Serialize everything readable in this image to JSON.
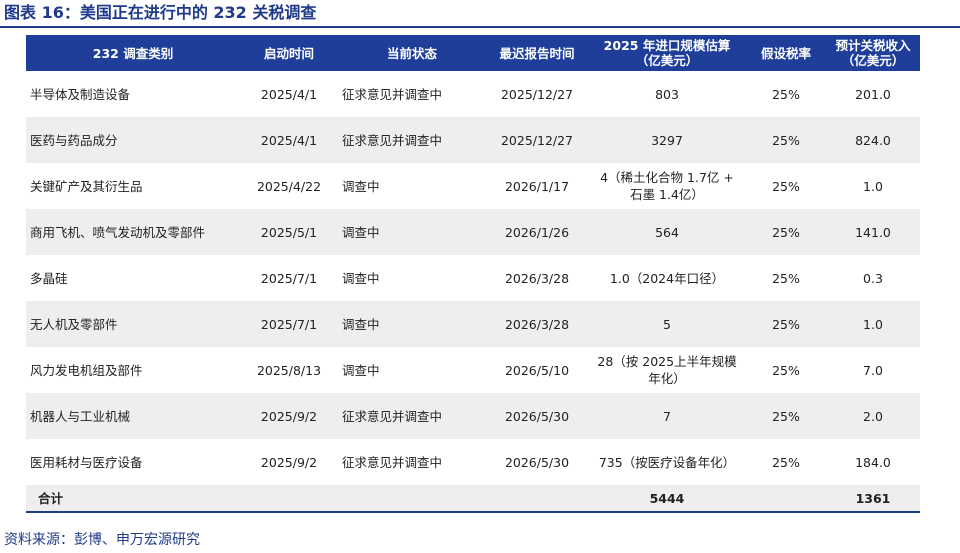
{
  "title": "图表 16：美国正在进行中的 232 关税调查",
  "table": {
    "headers": {
      "category": "232 调查类别",
      "start": "启动时间",
      "status": "当前状态",
      "report": "最迟报告时间",
      "import": "2025 年进口规模估算（亿美元）",
      "rate": "假设税率",
      "tariff": "预计关税收入（亿美元）"
    },
    "rows": [
      {
        "category": "半导体及制造设备",
        "start": "2025/4/1",
        "status": "征求意见并调查中",
        "report": "2025/12/27",
        "import": "803",
        "rate": "25%",
        "tariff": "201.0"
      },
      {
        "category": "医药与药品成分",
        "start": "2025/4/1",
        "status": "征求意见并调查中",
        "report": "2025/12/27",
        "import": "3297",
        "rate": "25%",
        "tariff": "824.0"
      },
      {
        "category": "关键矿产及其衍生品",
        "start": "2025/4/22",
        "status": "调查中",
        "report": "2026/1/17",
        "import": "4（稀土化合物 1.7亿 + 石墨 1.4亿）",
        "rate": "25%",
        "tariff": "1.0"
      },
      {
        "category": "商用飞机、喷气发动机及零部件",
        "start": "2025/5/1",
        "status": "调查中",
        "report": "2026/1/26",
        "import": "564",
        "rate": "25%",
        "tariff": "141.0"
      },
      {
        "category": "多晶硅",
        "start": "2025/7/1",
        "status": "调查中",
        "report": "2026/3/28",
        "import": "1.0（2024年口径）",
        "rate": "25%",
        "tariff": "0.3"
      },
      {
        "category": "无人机及零部件",
        "start": "2025/7/1",
        "status": "调查中",
        "report": "2026/3/28",
        "import": "5",
        "rate": "25%",
        "tariff": "1.0"
      },
      {
        "category": "风力发电机组及部件",
        "start": "2025/8/13",
        "status": "调查中",
        "report": "2026/5/10",
        "import": "28（按 2025上半年规模年化）",
        "rate": "25%",
        "tariff": "7.0"
      },
      {
        "category": "机器人与工业机械",
        "start": "2025/9/2",
        "status": "征求意见并调查中",
        "report": "2026/5/30",
        "import": "7",
        "rate": "25%",
        "tariff": "2.0"
      },
      {
        "category": "医用耗材与医疗设备",
        "start": "2025/9/2",
        "status": "征求意见并调查中",
        "report": "2026/5/30",
        "import": "735（按医疗设备年化）",
        "rate": "25%",
        "tariff": "184.0"
      }
    ],
    "total": {
      "label": "合计",
      "import": "5444",
      "tariff": "1361"
    }
  },
  "source": "资料来源：彭博、申万宏源研究",
  "colors": {
    "accent": "#1e3e9a",
    "stripe": "#eeeeee"
  }
}
